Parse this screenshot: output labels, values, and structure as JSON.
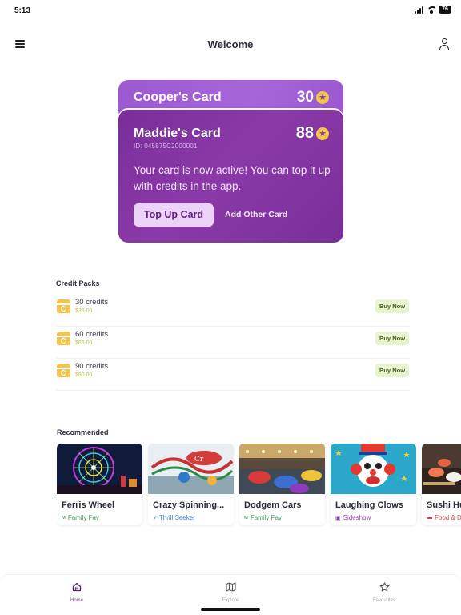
{
  "status_bar": {
    "time": "5:13",
    "battery": "76"
  },
  "header": {
    "title": "Welcome"
  },
  "cards": {
    "back": {
      "name": "Cooper's Card",
      "points": "30"
    },
    "front": {
      "name": "Maddie's Card",
      "points": "88",
      "id_text": "ID: 045875C2000001",
      "message": "Your card is now active! You can top it up with credits in the app.",
      "top_up_label": "Top Up Card",
      "add_other_label": "Add Other Card"
    }
  },
  "credit_packs": {
    "title": "Credit Packs",
    "buy_label": "Buy Now",
    "items": [
      {
        "title": "30 credits",
        "price": "$35.00"
      },
      {
        "title": "60 credits",
        "price": "$65.00"
      },
      {
        "title": "90 credits",
        "price": "$90.00"
      }
    ]
  },
  "recommended": {
    "title": "Recommended",
    "items": [
      {
        "title": "Ferris Wheel",
        "tag": "Family Fav",
        "tag_color": "#3e9a5a"
      },
      {
        "title": "Crazy Spinning...",
        "tag": "Thrill Seeker",
        "tag_color": "#3b7bd6"
      },
      {
        "title": "Dodgem Cars",
        "tag": "Family Fav",
        "tag_color": "#3e9a5a"
      },
      {
        "title": "Laughing Clows",
        "tag": "Sideshow",
        "tag_color": "#8a3db0"
      },
      {
        "title": "Sushi Hu",
        "tag": "Food & D",
        "tag_color": "#d6453d"
      }
    ]
  },
  "nav": {
    "home": "Home",
    "explore": "Explore",
    "favourites": "Favourites"
  },
  "colors": {
    "accent": "#7a2d98",
    "card_light": "#a666d8",
    "coin": "#f3c54f",
    "buy_bg": "#e8f3cf"
  }
}
